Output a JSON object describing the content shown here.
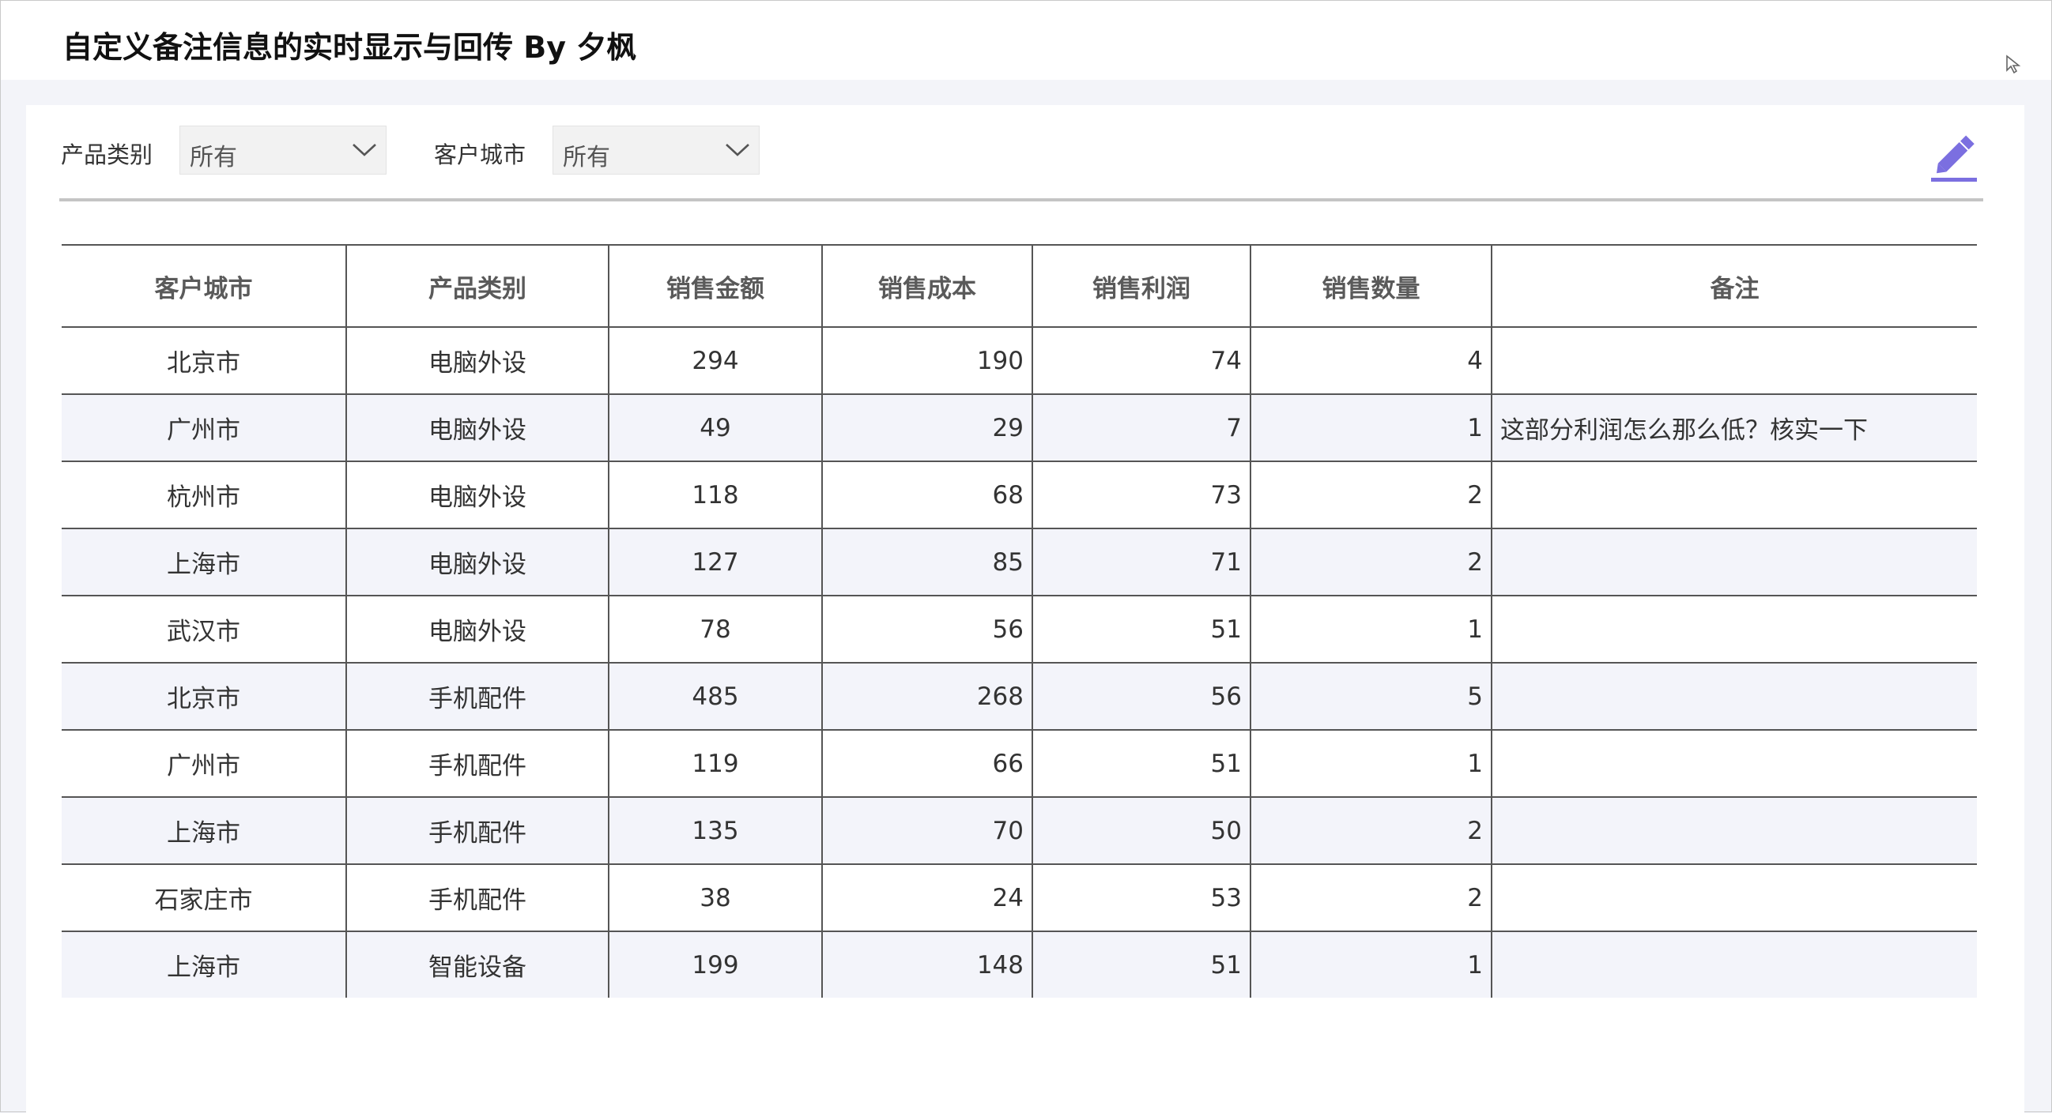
{
  "title": "自定义备注信息的实时显示与回传 By 夕枫",
  "filters": [
    {
      "label": "产品类别",
      "value": "所有"
    },
    {
      "label": "客户城市",
      "value": "所有"
    }
  ],
  "table": {
    "headers": [
      "客户城市",
      "产品类别",
      "销售金额",
      "销售成本",
      "销售利润",
      "销售数量",
      "备注"
    ],
    "rows": [
      [
        "北京市",
        "电脑外设",
        "294",
        "190",
        "74",
        "4",
        ""
      ],
      [
        "广州市",
        "电脑外设",
        "49",
        "29",
        "7",
        "1",
        "这部分利润怎么那么低？核实一下"
      ],
      [
        "杭州市",
        "电脑外设",
        "118",
        "68",
        "73",
        "2",
        ""
      ],
      [
        "上海市",
        "电脑外设",
        "127",
        "85",
        "71",
        "2",
        ""
      ],
      [
        "武汉市",
        "电脑外设",
        "78",
        "56",
        "51",
        "1",
        ""
      ],
      [
        "北京市",
        "手机配件",
        "485",
        "268",
        "56",
        "5",
        ""
      ],
      [
        "广州市",
        "手机配件",
        "119",
        "66",
        "51",
        "1",
        ""
      ],
      [
        "上海市",
        "手机配件",
        "135",
        "70",
        "50",
        "2",
        ""
      ],
      [
        "石家庄市",
        "手机配件",
        "38",
        "24",
        "53",
        "2",
        ""
      ],
      [
        "上海市",
        "智能设备",
        "199",
        "148",
        "51",
        "1",
        ""
      ]
    ]
  },
  "icons": {
    "edit": "pencil-icon",
    "dropdown": "chevron-down-icon",
    "cursor": "mouse-pointer-icon"
  },
  "colors": {
    "accent": "#7b6fe0",
    "stripe": "#f3f4fa",
    "background": "#f3f4f9"
  }
}
